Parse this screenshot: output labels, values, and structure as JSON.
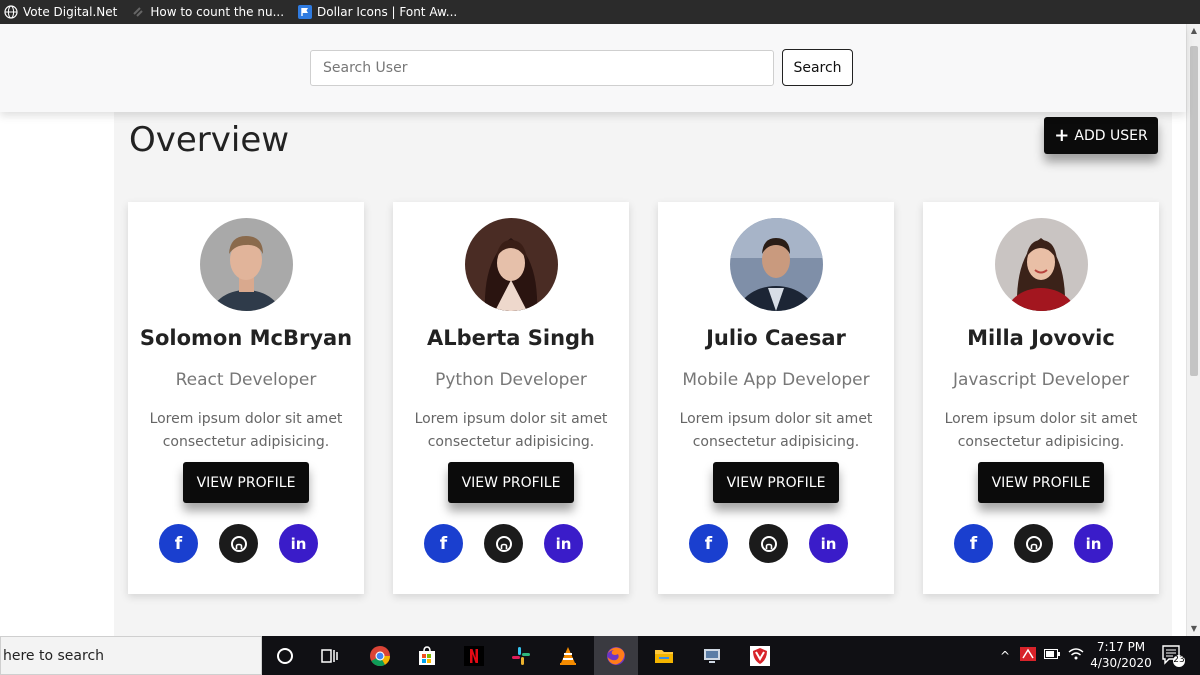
{
  "bookmarks": [
    {
      "label": "Vote Digital.Net",
      "icon": "globe-icon"
    },
    {
      "label": "How to count the nu...",
      "icon": "link-icon"
    },
    {
      "label": "Dollar Icons | Font Aw...",
      "icon": "flag-icon"
    }
  ],
  "header": {
    "search_placeholder": "Search User",
    "search_button": "Search"
  },
  "main": {
    "title": "Overview",
    "add_user_label": "ADD USER"
  },
  "users": [
    {
      "name": "Solomon McBryan",
      "role": "React Developer",
      "description": "Lorem ipsum dolor sit amet consectetur adipisicing.",
      "button": "VIEW PROFILE"
    },
    {
      "name": "ALberta Singh",
      "role": "Python Developer",
      "description": "Lorem ipsum dolor sit amet consectetur adipisicing.",
      "button": "VIEW PROFILE"
    },
    {
      "name": "Julio Caesar",
      "role": "Mobile App Developer",
      "description": "Lorem ipsum dolor sit amet consectetur adipisicing.",
      "button": "VIEW PROFILE"
    },
    {
      "name": "Milla Jovovic",
      "role": "Javascript Developer",
      "description": "Lorem ipsum dolor sit amet consectetur adipisicing.",
      "button": "VIEW PROFILE"
    }
  ],
  "socials": {
    "facebook": "f",
    "linkedin": "in"
  },
  "colors": {
    "facebook": "#1a3fcf",
    "github": "#1b1b1b",
    "linkedin": "#3a1cc9",
    "button_dark": "#0b0b0b"
  },
  "taskbar": {
    "search_text": "here to search",
    "time": "7:17 PM",
    "date": "4/30/2020",
    "notification_count": "23"
  }
}
